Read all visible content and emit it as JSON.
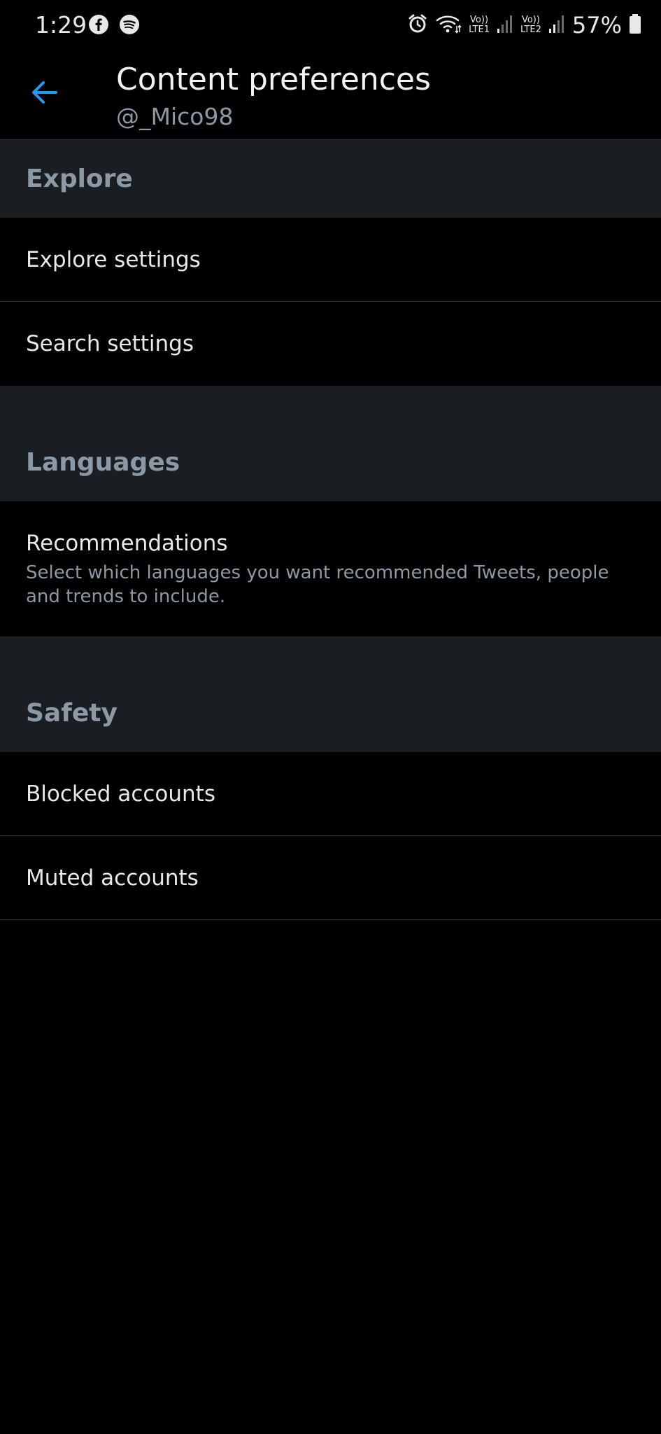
{
  "status_bar": {
    "time": "1:29",
    "left_icons": [
      "facebook-icon",
      "spotify-icon"
    ],
    "right_icons": [
      "alarm-icon",
      "wifi-icon",
      "signal-icon"
    ],
    "lte1_top": "Vo))",
    "lte1_bottom": "LTE1",
    "lte2_top": "Vo))",
    "lte2_bottom": "LTE2",
    "battery": "57%"
  },
  "header": {
    "title": "Content preferences",
    "subtitle": "@_Mico98",
    "back_icon": "arrow-left-icon",
    "accent_color": "#1d9bf0"
  },
  "sections": {
    "explore": {
      "title": "Explore",
      "items": [
        "Explore settings",
        "Search settings"
      ]
    },
    "languages": {
      "title": "Languages",
      "items": [
        {
          "label": "Recommendations",
          "description": "Select which languages you want recommended Tweets, people and trends to include."
        }
      ]
    },
    "safety": {
      "title": "Safety",
      "items": [
        "Blocked accounts",
        "Muted accounts"
      ]
    }
  },
  "colors": {
    "background": "#000000",
    "section_background": "#1a1d22",
    "secondary_text": "#8b98a5",
    "primary_text": "#e7e9ea"
  }
}
